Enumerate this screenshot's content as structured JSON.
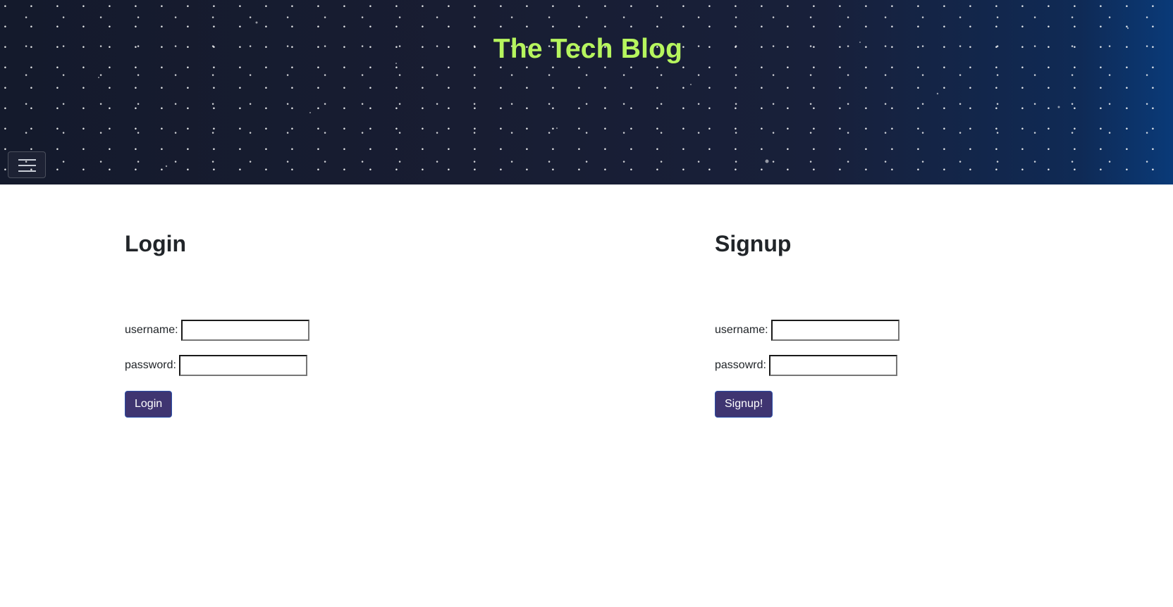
{
  "header": {
    "title": "The Tech Blog",
    "title_color": "#b6f55e",
    "menu_icon": "hamburger-menu-icon"
  },
  "login": {
    "heading": "Login",
    "username_label": "username:",
    "username_value": "",
    "password_label": "password:",
    "password_value": "",
    "button_label": "Login"
  },
  "signup": {
    "heading": "Signup",
    "username_label": "username:",
    "username_value": "",
    "password_label": "passowrd:",
    "password_value": "",
    "button_label": "Signup!"
  },
  "colors": {
    "button_bg": "#3f3571",
    "header_bg": "#181d32"
  }
}
